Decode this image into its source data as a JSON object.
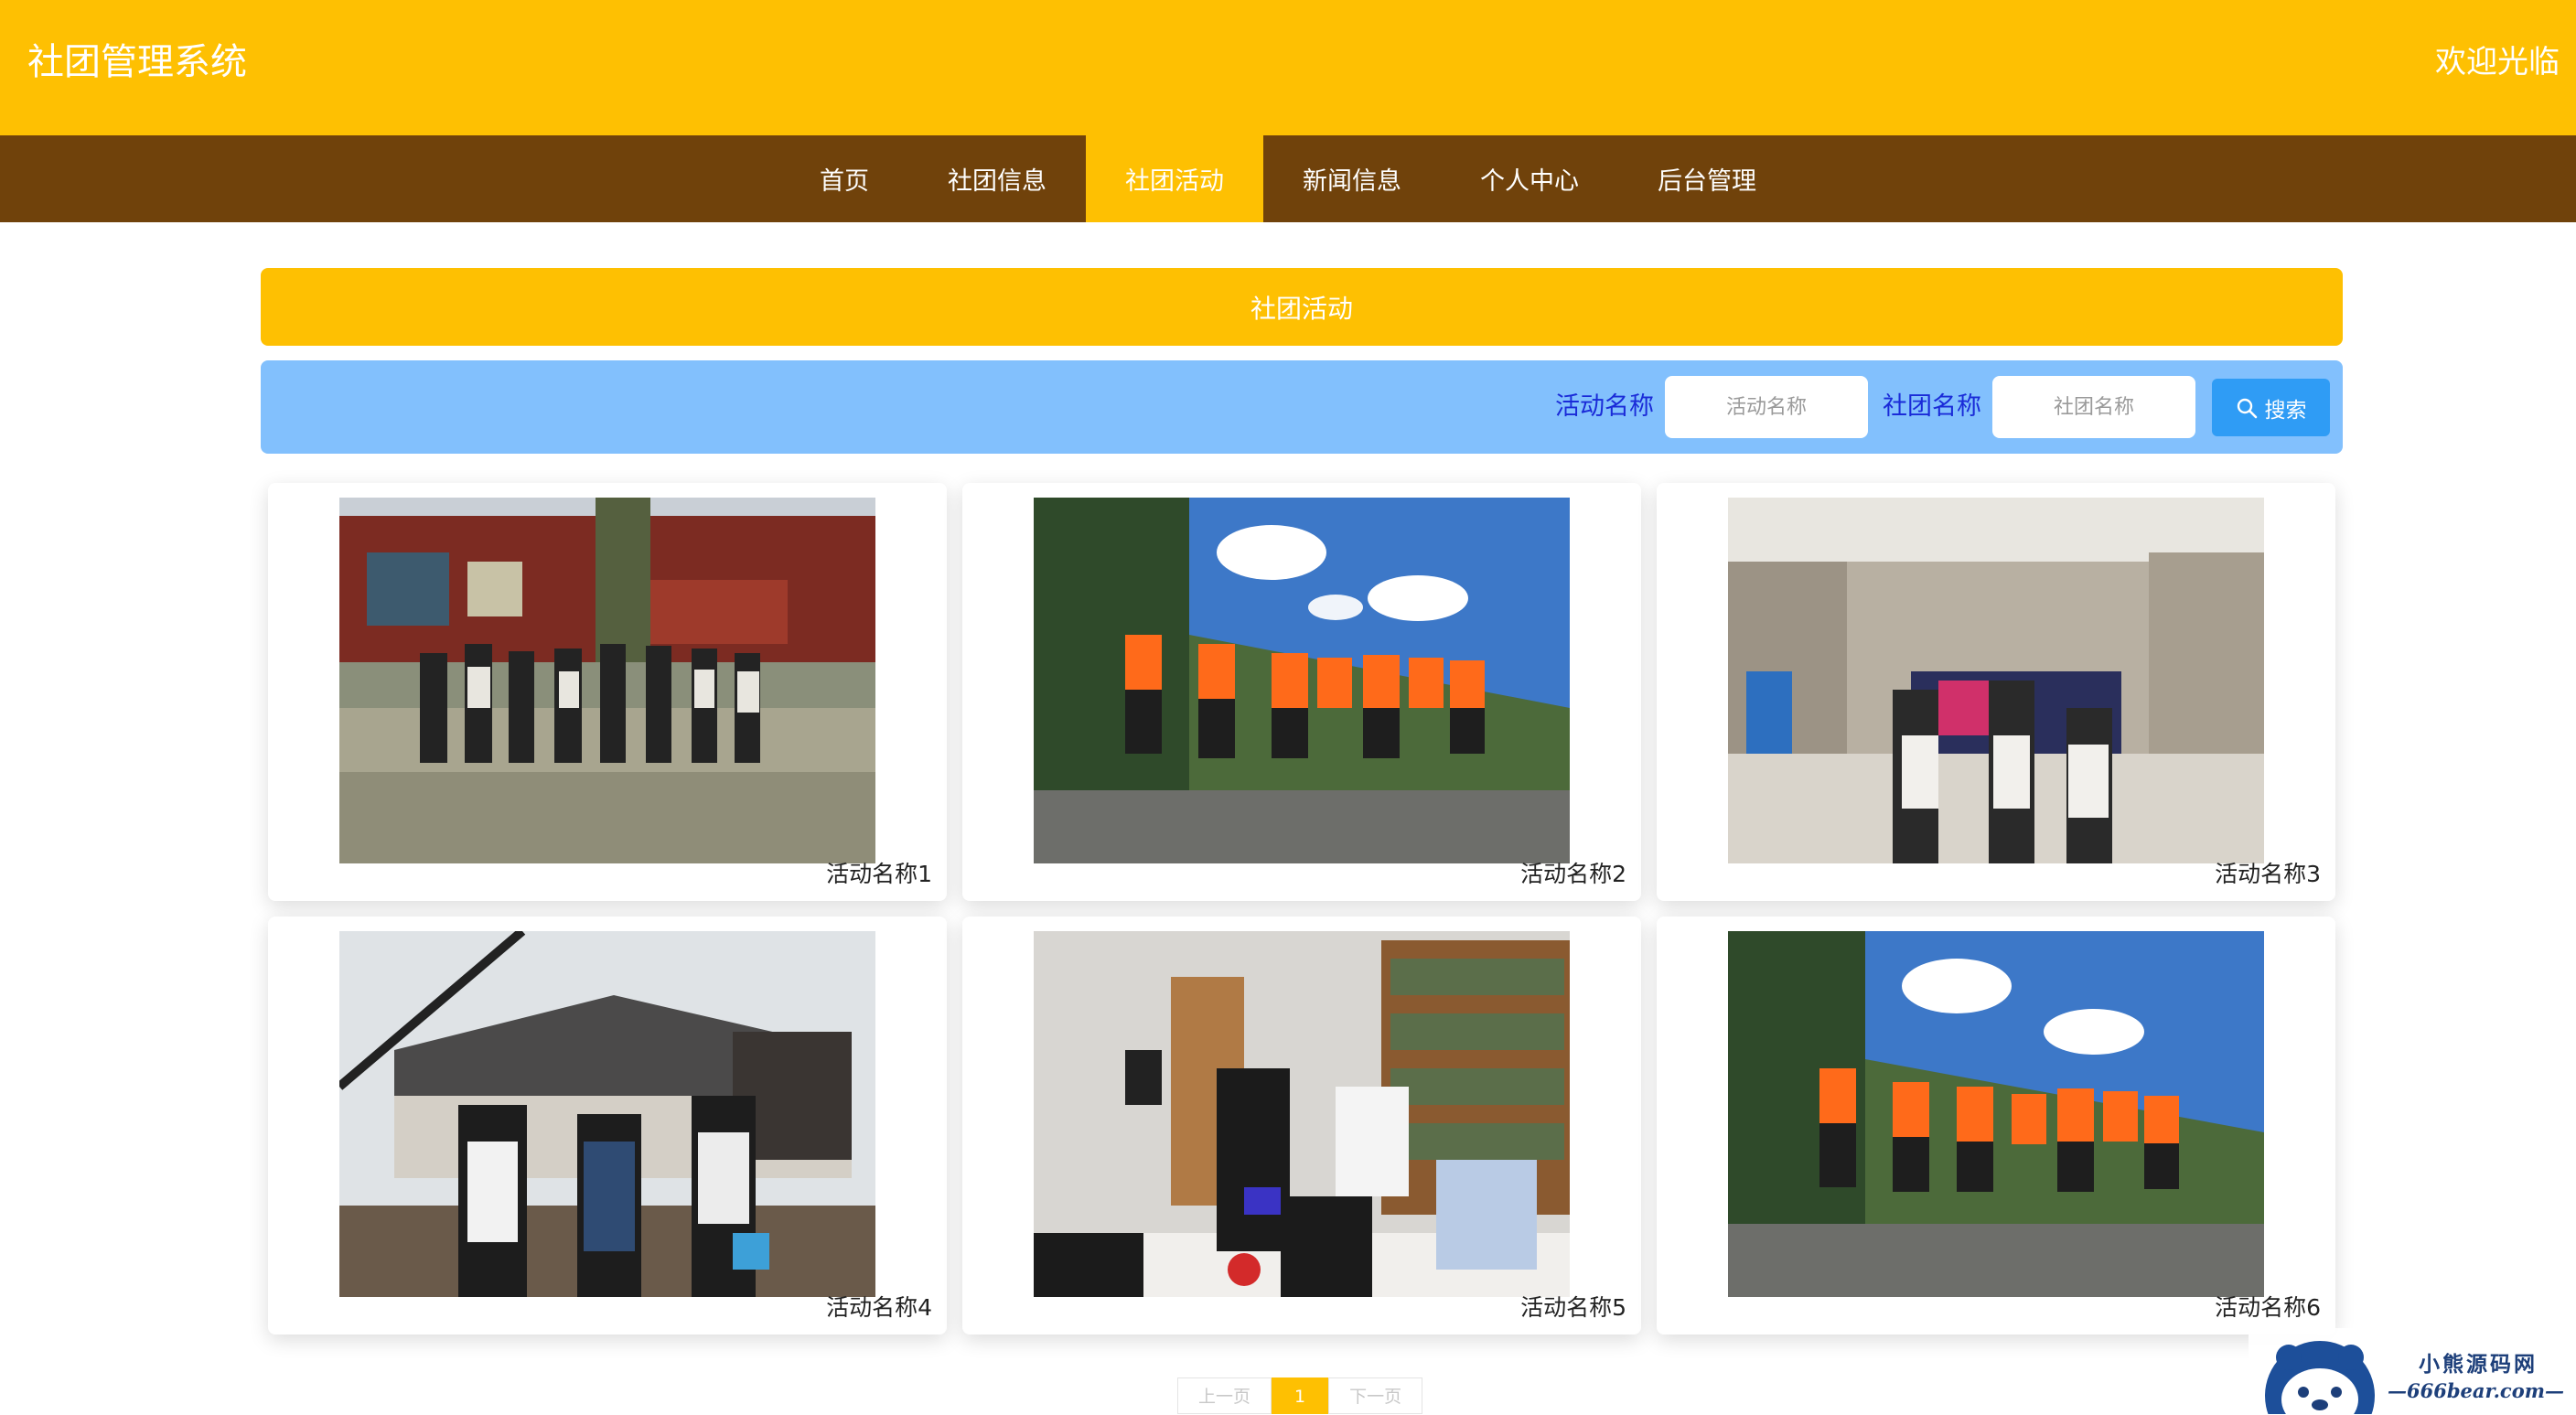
{
  "header": {
    "app_title": "社团管理系统",
    "welcome": "欢迎光临"
  },
  "nav": {
    "items": [
      {
        "label": "首页"
      },
      {
        "label": "社团信息"
      },
      {
        "label": "社团活动"
      },
      {
        "label": "新闻信息"
      },
      {
        "label": "个人中心"
      },
      {
        "label": "后台管理"
      }
    ],
    "active": "社团活动"
  },
  "section": {
    "title": "社团活动"
  },
  "search": {
    "activity_label": "活动名称",
    "activity_placeholder": "活动名称",
    "club_label": "社团名称",
    "club_placeholder": "社团名称",
    "button_label": "搜索",
    "button_icon": "search-icon"
  },
  "activities": [
    {
      "name": "活动名称1",
      "photo": "group photo in front of temple"
    },
    {
      "name": "活动名称2",
      "photo": "group in orange life jackets outdoors"
    },
    {
      "name": "活动名称3",
      "photo": "conference hall group photo"
    },
    {
      "name": "活动名称4",
      "photo": "three students on bridge"
    },
    {
      "name": "活动名称5",
      "photo": "people at table in library"
    },
    {
      "name": "活动名称6",
      "photo": "group in orange life jackets waving"
    }
  ],
  "pagination": {
    "prev": "上一页",
    "current": "1",
    "next": "下一页"
  },
  "watermark": {
    "line1": "小熊源码网",
    "line2": "—666bear.com—"
  },
  "colors": {
    "header_bg": "#fec002",
    "nav_bg": "#70420b",
    "search_bg": "#82c0fd",
    "search_label": "#1a2bd8",
    "button_bg": "#2f9cf5"
  }
}
